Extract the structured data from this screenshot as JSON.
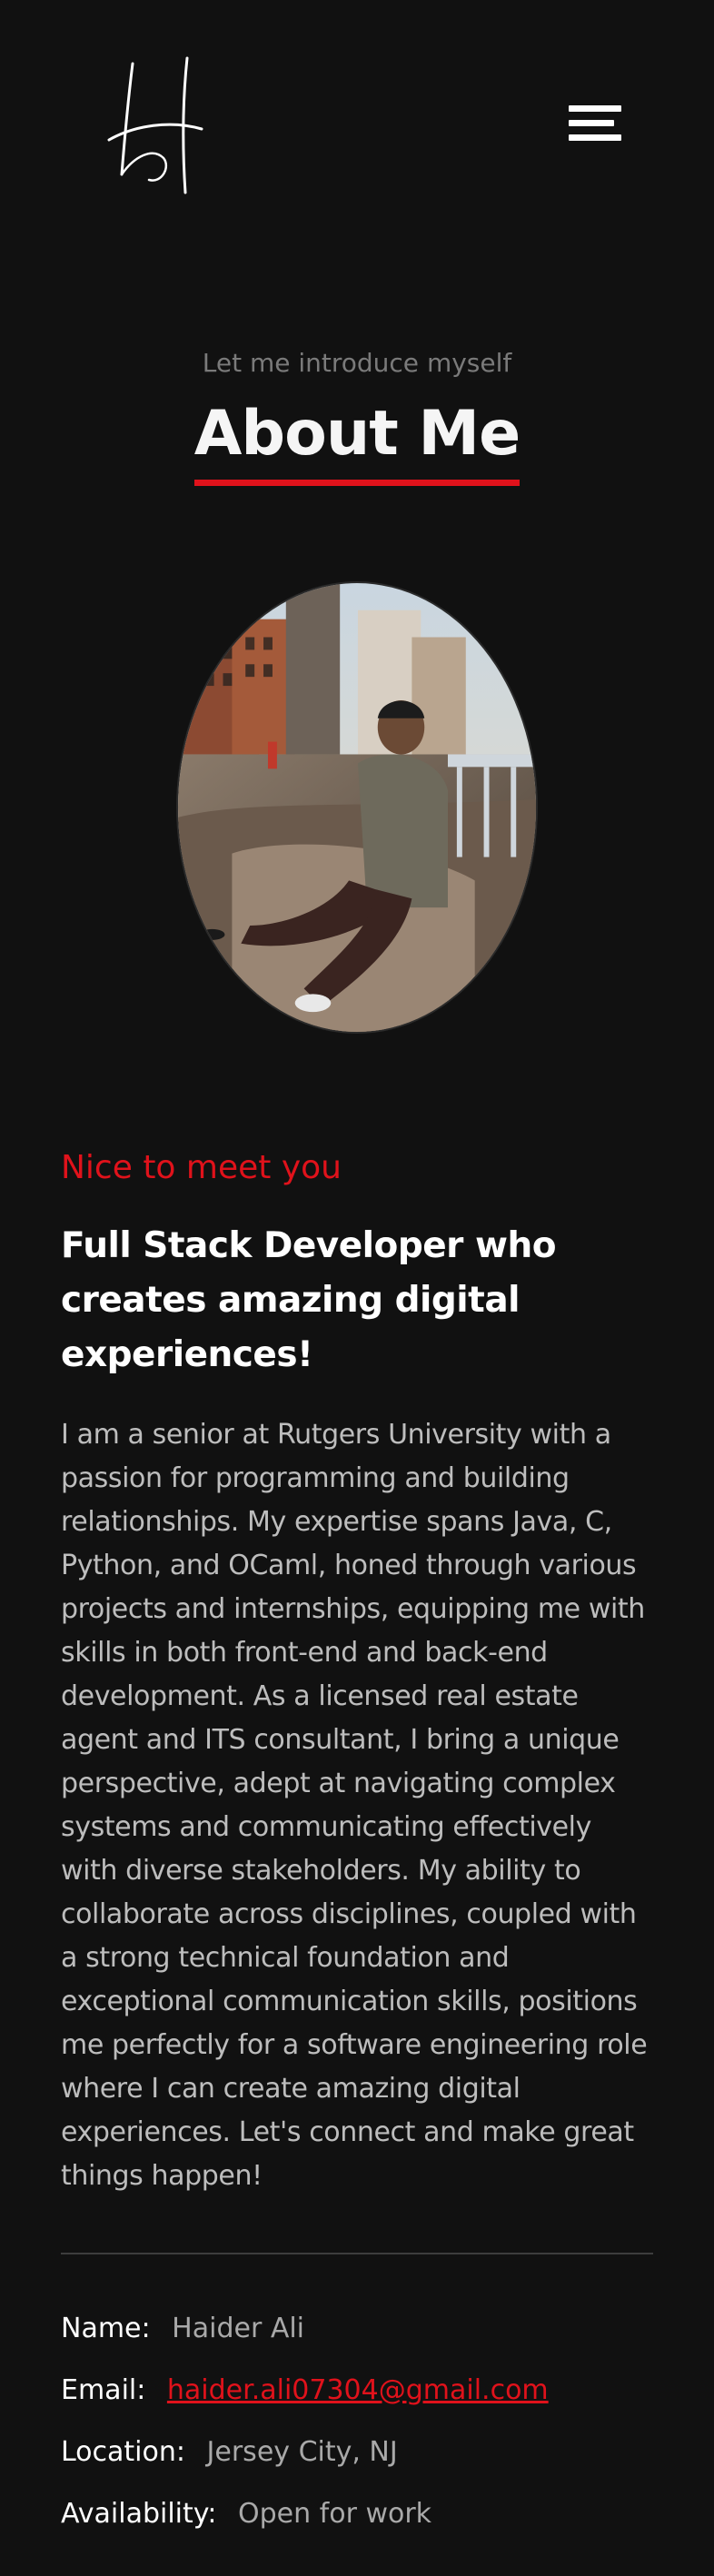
{
  "header": {
    "logo_icon": "handwritten-h-logo",
    "menu_icon": "hamburger-menu-icon"
  },
  "section": {
    "kicker": "Let me introduce myself",
    "title": "About Me",
    "accent_color": "#e0121b"
  },
  "portrait": {
    "icon": "profile-photo"
  },
  "about": {
    "greeting": "Nice to meet you",
    "headline": "Full Stack Developer who creates amazing digital experiences!",
    "bio": "I am a senior at Rutgers University with a passion for programming and building relationships. My expertise spans Java, C, Python, and OCaml, honed through various projects and internships, equipping me with skills in both front-end and back-end development. As a licensed real estate agent and ITS consultant, I bring a unique perspective, adept at navigating complex systems and communicating effectively with diverse stakeholders. My ability to collaborate across disciplines, coupled with a strong technical foundation and exceptional communication skills, positions me perfectly for a software engineering role where I can create amazing digital experiences. Let's connect and make great things happen!"
  },
  "info": {
    "name_label": "Name:",
    "name_value": "Haider Ali",
    "email_label": "Email:",
    "email_value": "haider.ali07304@gmail.com",
    "location_label": "Location:",
    "location_value": "Jersey City, NJ",
    "availability_label": "Availability:",
    "availability_value": "Open for work"
  },
  "colors": {
    "background": "#111111",
    "accent": "#e0121b",
    "muted_text": "#bdbdbd"
  }
}
